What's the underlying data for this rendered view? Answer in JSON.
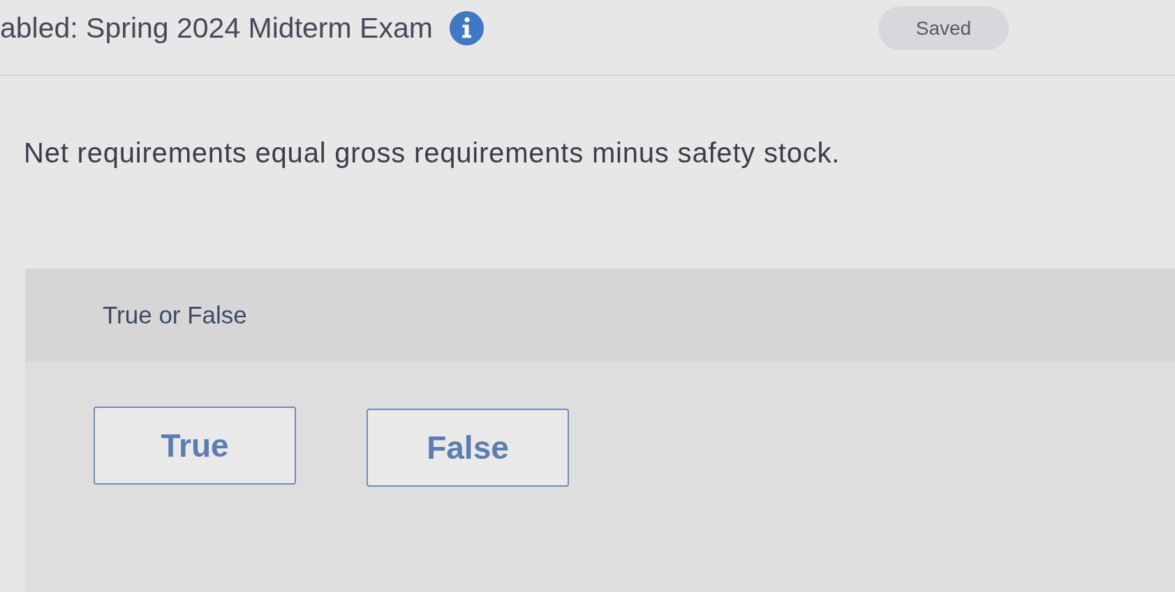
{
  "header": {
    "title": "abled: Spring 2024 Midterm Exam",
    "status": "Saved"
  },
  "question": {
    "text": "Net requirements equal gross requirements minus safety stock.",
    "prompt": "True or False",
    "options": [
      {
        "label": "True",
        "selected": false
      },
      {
        "label": "False",
        "selected": false
      }
    ]
  }
}
